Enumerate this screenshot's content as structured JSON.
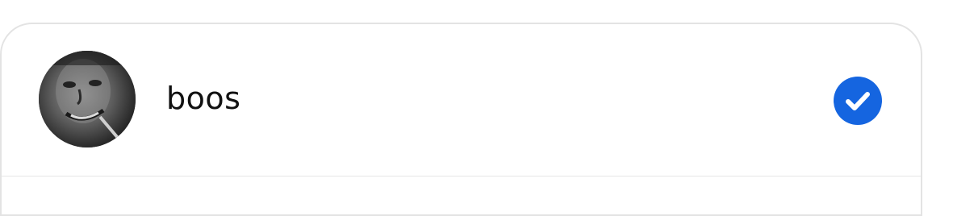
{
  "account": {
    "username": "boos",
    "selected": true,
    "avatar_icon": "user-photo-avatar",
    "check_icon": "checkmark-circle-icon"
  },
  "colors": {
    "accent": "#1565e0",
    "border": "#e3e3e3",
    "text": "#111111"
  }
}
